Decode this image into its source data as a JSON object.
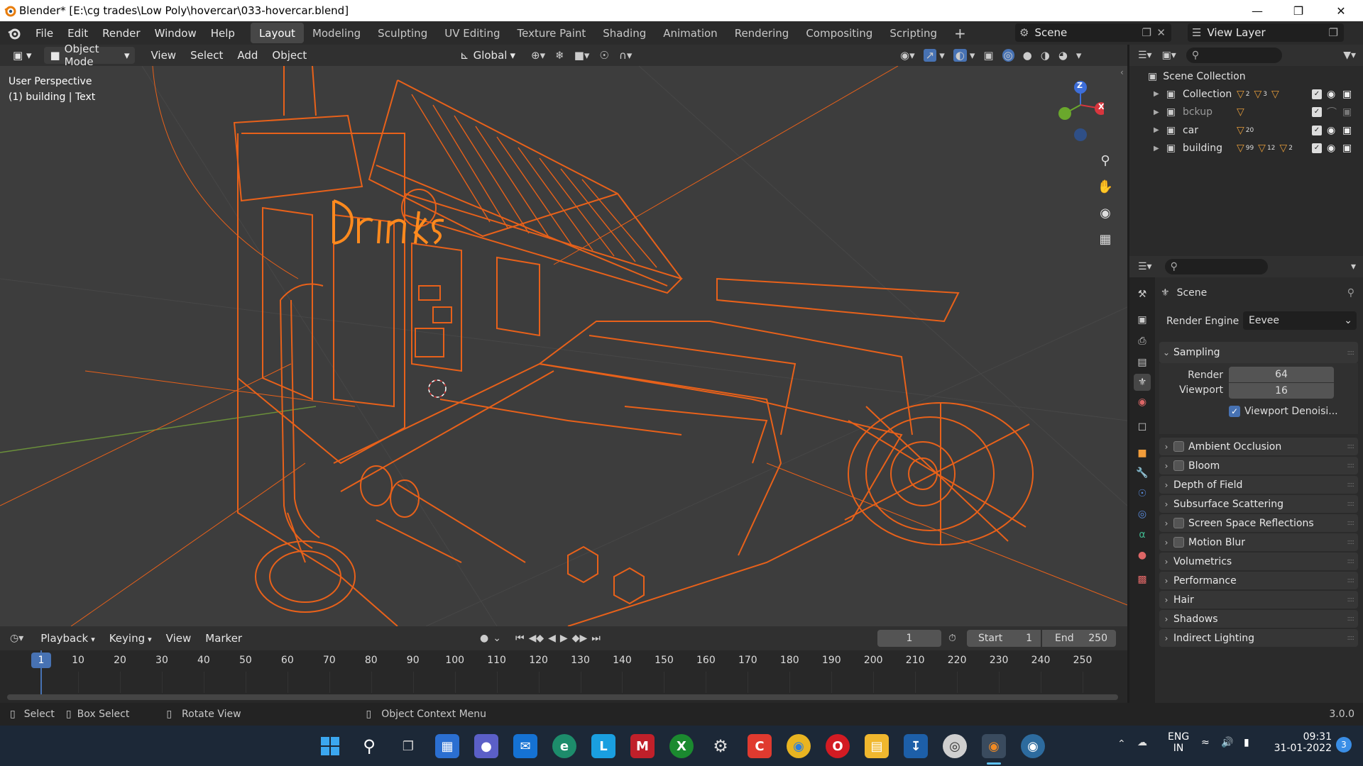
{
  "window": {
    "title": "Blender* [E:\\cg trades\\Low Poly\\hovercar\\033-hovercar.blend]"
  },
  "menu": [
    "File",
    "Edit",
    "Render",
    "Window",
    "Help"
  ],
  "workspaces": [
    "Layout",
    "Modeling",
    "Sculpting",
    "UV Editing",
    "Texture Paint",
    "Shading",
    "Animation",
    "Rendering",
    "Compositing",
    "Scripting"
  ],
  "scene_field": "Scene",
  "view_layer_field": "View Layer",
  "viewport_header": {
    "mode": "Object Mode",
    "menus": [
      "View",
      "Select",
      "Add",
      "Object"
    ],
    "transform": "Global"
  },
  "viewport": {
    "perspective": "User Perspective",
    "active_info": "(1) building | Text",
    "sign_text": "Drinks",
    "gizmo_z": "Z",
    "gizmo_x": "X"
  },
  "outliner": {
    "root": "Scene Collection",
    "collections": [
      {
        "name": "Collection",
        "counts": [
          "2",
          "3",
          ""
        ]
      },
      {
        "name": "bckup",
        "counts": [
          ""
        ]
      },
      {
        "name": "car",
        "counts": [
          "20"
        ]
      },
      {
        "name": "building",
        "counts": [
          "99",
          "12",
          "2"
        ]
      }
    ]
  },
  "properties": {
    "context": "Scene",
    "render_engine_label": "Render Engine",
    "render_engine_value": "Eevee",
    "sampling": {
      "title": "Sampling",
      "render_label": "Render",
      "render_value": "64",
      "viewport_label": "Viewport",
      "viewport_value": "16",
      "denoise_label": "Viewport Denoisi..."
    },
    "panels": [
      {
        "label": "Ambient Occlusion",
        "checkbox": true
      },
      {
        "label": "Bloom",
        "checkbox": true
      },
      {
        "label": "Depth of Field",
        "checkbox": false
      },
      {
        "label": "Subsurface Scattering",
        "checkbox": false
      },
      {
        "label": "Screen Space Reflections",
        "checkbox": true
      },
      {
        "label": "Motion Blur",
        "checkbox": true
      },
      {
        "label": "Volumetrics",
        "checkbox": false
      },
      {
        "label": "Performance",
        "checkbox": false
      },
      {
        "label": "Hair",
        "checkbox": false
      },
      {
        "label": "Shadows",
        "checkbox": false
      },
      {
        "label": "Indirect Lighting",
        "checkbox": false
      }
    ]
  },
  "timeline": {
    "menus": [
      "Playback",
      "Keying",
      "View",
      "Marker"
    ],
    "current_frame": "1",
    "start_label": "Start",
    "start_value": "1",
    "end_label": "End",
    "end_value": "250",
    "ticks": [
      "1",
      "10",
      "20",
      "30",
      "40",
      "50",
      "60",
      "70",
      "80",
      "90",
      "100",
      "110",
      "120",
      "130",
      "140",
      "150",
      "160",
      "170",
      "180",
      "190",
      "200",
      "210",
      "220",
      "230",
      "240",
      "250"
    ]
  },
  "statusbar": {
    "select": "Select",
    "box_select": "Box Select",
    "rotate_view": "Rotate View",
    "context_menu": "Object Context Menu",
    "version": "3.0.0"
  },
  "taskbar": {
    "lang1": "ENG",
    "lang2": "IN",
    "time": "09:31",
    "date": "31-01-2022",
    "notif": "3"
  },
  "colors": {
    "wire": "#e8611a",
    "active": "#ff8a1e",
    "accent": "#4772b3",
    "bg": "#3d3d3d"
  }
}
